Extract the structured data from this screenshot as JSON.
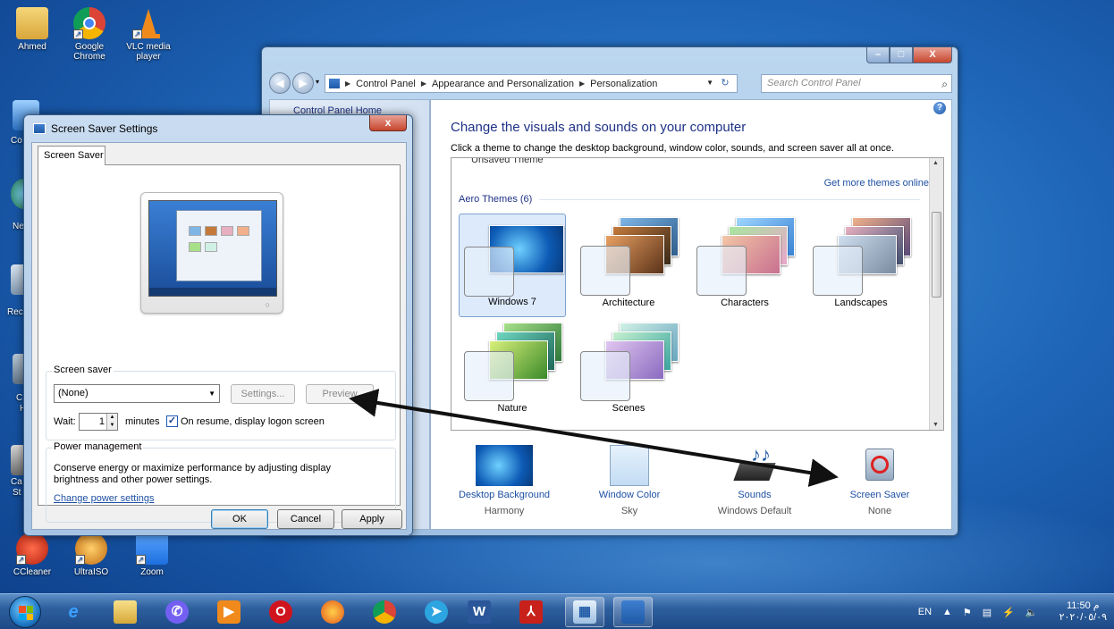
{
  "desktop": {
    "icons": [
      {
        "label": "Ahmed"
      },
      {
        "label": "Google Chrome"
      },
      {
        "label": "VLC media player"
      },
      {
        "label": "CCleaner"
      },
      {
        "label": "UltraISO"
      },
      {
        "label": "Zoom"
      }
    ],
    "partial_labels": [
      "Co",
      "Ne",
      "Rec",
      "C",
      "H",
      "Ca",
      "St"
    ]
  },
  "control_panel": {
    "title_buttons": {
      "minimize": "–",
      "maximize": "□",
      "close": "X"
    },
    "breadcrumb": [
      "Control Panel",
      "Appearance and Personalization",
      "Personalization"
    ],
    "search_placeholder": "Search Control Panel",
    "left_pane_text": "Control Panel Home",
    "heading": "Change the visuals and sounds on your computer",
    "subheading": "Click a theme to change the desktop background, window color, sounds, and screen saver all at once.",
    "unsaved_theme": "Unsaved Theme",
    "get_more": "Get more themes online",
    "aero_label": "Aero Themes (6)",
    "themes": [
      {
        "name": "Windows 7",
        "selected": true
      },
      {
        "name": "Architecture",
        "selected": false
      },
      {
        "name": "Characters",
        "selected": false
      },
      {
        "name": "Landscapes",
        "selected": false
      },
      {
        "name": "Nature",
        "selected": false
      },
      {
        "name": "Scenes",
        "selected": false
      }
    ],
    "bottom_items": [
      {
        "link": "Desktop Background",
        "value": "Harmony"
      },
      {
        "link": "Window Color",
        "value": "Sky"
      },
      {
        "link": "Sounds",
        "value": "Windows Default"
      },
      {
        "link": "Screen Saver",
        "value": "None"
      }
    ]
  },
  "screen_saver_dialog": {
    "title": "Screen Saver Settings",
    "close": "x",
    "tab": "Screen Saver",
    "group_label": "Screen saver",
    "selected_saver": "(None)",
    "settings_button": "Settings...",
    "preview_button": "Preview",
    "wait_label": "Wait:",
    "wait_value": "1",
    "minutes_label": "minutes",
    "resume_checked": true,
    "resume_label": "On resume, display logon screen",
    "power_label": "Power management",
    "power_text": "Conserve energy or maximize performance by adjusting display brightness and other power settings.",
    "power_link": "Change power settings",
    "ok": "OK",
    "cancel": "Cancel",
    "apply": "Apply"
  },
  "taskbar": {
    "language": "EN",
    "time": "11:50 م",
    "date": "٢٠٢٠/٠٥/٠٩"
  },
  "colors": {
    "link": "#1e50a2",
    "heading": "#1e3287",
    "arrow": "#111111"
  }
}
